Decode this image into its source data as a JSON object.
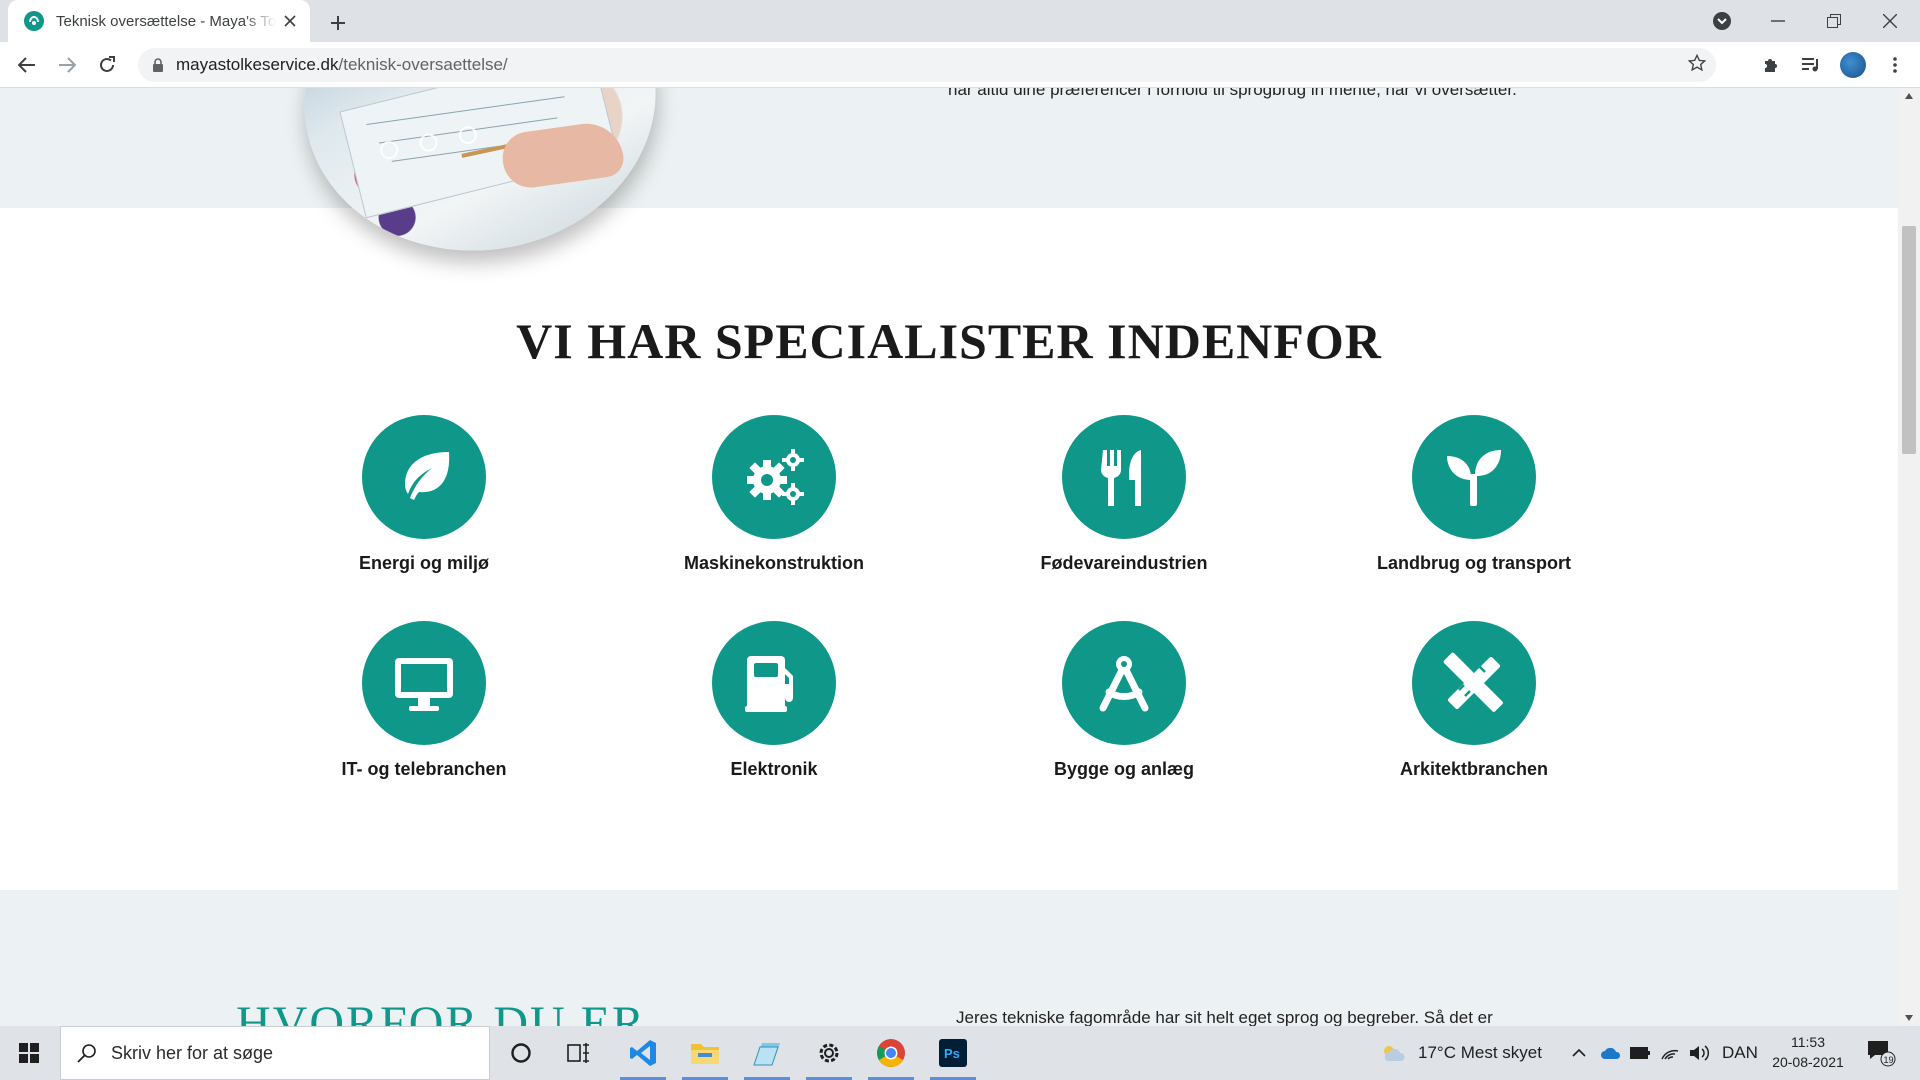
{
  "browser": {
    "tab_title": "Teknisk oversættelse - Maya's Tolkeservice",
    "url_domain": "mayastolkeservice.dk",
    "url_path": "/teknisk-oversaettelse/"
  },
  "page": {
    "top_text": "har altid dine præferencer i forhold til sprogbrug in mente, når vi oversætter.",
    "section_title": "VI HAR SPECIALISTER INDENFOR",
    "specialties": [
      {
        "label": "Energi og miljø",
        "icon": "leaf-icon"
      },
      {
        "label": "Maskinekonstruktion",
        "icon": "gears-icon"
      },
      {
        "label": "Fødevareindustrien",
        "icon": "utensils-icon"
      },
      {
        "label": "Landbrug og transport",
        "icon": "seedling-icon"
      },
      {
        "label": "IT- og telebranchen",
        "icon": "monitor-icon"
      },
      {
        "label": "Elektronik",
        "icon": "gas-pump-icon"
      },
      {
        "label": "Bygge og anlæg",
        "icon": "compass-drafting-icon"
      },
      {
        "label": "Arkitektbranchen",
        "icon": "pencil-ruler-icon"
      }
    ],
    "why_title": "HVORFOR DU ER",
    "why_text": "Jeres tekniske fagområde har sit helt eget sprog og begreber. Så det er",
    "accent_color": "#0f978a"
  },
  "taskbar": {
    "search_placeholder": "Skriv her for at søge",
    "weather": "17°C  Mest skyet",
    "language": "DAN",
    "time": "11:53",
    "date": "20-08-2021",
    "notifications": "19"
  }
}
